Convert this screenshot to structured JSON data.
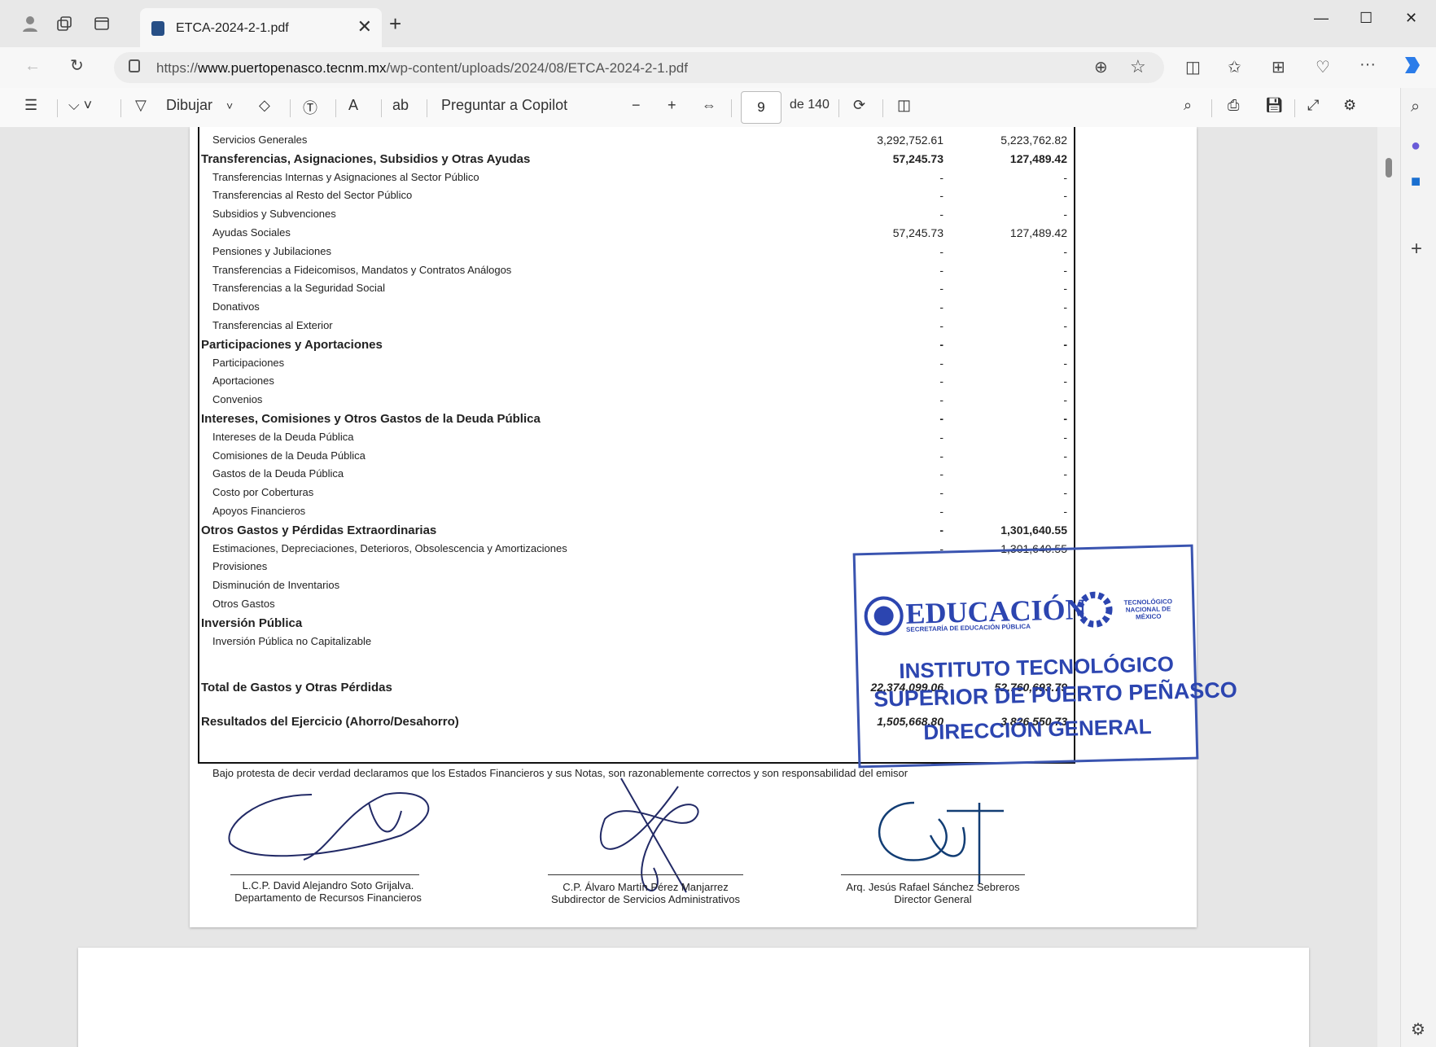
{
  "browser": {
    "tab_title": "ETCA-2024-2-1.pdf",
    "url_prefix": "https://",
    "url_host": "www.puertopenasco.tecnm.mx",
    "url_path": "/wp-content/uploads/2024/08/ETCA-2024-2-1.pdf"
  },
  "pdf_toolbar": {
    "draw_label": "Dibujar",
    "copilot_label": "Preguntar a Copilot",
    "page_number": "9",
    "page_total": "de 140"
  },
  "document": {
    "rows": [
      {
        "label": "Servicios Generales",
        "kind": "sub",
        "v1": "3,292,752.61",
        "v2": "5,223,762.82"
      },
      {
        "label": "Transferencias, Asignaciones, Subsidios y Otras Ayudas",
        "kind": "head",
        "v1": "57,245.73",
        "v2": "127,489.42"
      },
      {
        "label": "Transferencias Internas y Asignaciones al Sector Público",
        "kind": "sub",
        "v1": "-",
        "v2": "-"
      },
      {
        "label": "Transferencias al Resto del Sector Público",
        "kind": "sub",
        "v1": "-",
        "v2": "-"
      },
      {
        "label": "Subsidios y Subvenciones",
        "kind": "sub",
        "v1": "-",
        "v2": "-"
      },
      {
        "label": "Ayudas Sociales",
        "kind": "sub",
        "v1": "57,245.73",
        "v2": "127,489.42"
      },
      {
        "label": "Pensiones y Jubilaciones",
        "kind": "sub",
        "v1": "-",
        "v2": "-"
      },
      {
        "label": "Transferencias a Fideicomisos, Mandatos y Contratos Análogos",
        "kind": "sub",
        "v1": "-",
        "v2": "-"
      },
      {
        "label": "Transferencias a la Seguridad Social",
        "kind": "sub",
        "v1": "-",
        "v2": "-"
      },
      {
        "label": "Donativos",
        "kind": "sub",
        "v1": "-",
        "v2": "-"
      },
      {
        "label": "Transferencias al Exterior",
        "kind": "sub",
        "v1": "-",
        "v2": "-"
      },
      {
        "label": "Participaciones y Aportaciones",
        "kind": "head",
        "v1": "-",
        "v2": "-"
      },
      {
        "label": "Participaciones",
        "kind": "sub",
        "v1": "-",
        "v2": "-"
      },
      {
        "label": "Aportaciones",
        "kind": "sub",
        "v1": "-",
        "v2": "-"
      },
      {
        "label": "Convenios",
        "kind": "sub",
        "v1": "-",
        "v2": "-"
      },
      {
        "label": "Intereses, Comisiones y Otros Gastos de la Deuda Pública",
        "kind": "head",
        "v1": "-",
        "v2": "-"
      },
      {
        "label": "Intereses de la Deuda Pública",
        "kind": "sub",
        "v1": "-",
        "v2": "-"
      },
      {
        "label": "Comisiones de la Deuda Pública",
        "kind": "sub",
        "v1": "-",
        "v2": "-"
      },
      {
        "label": "Gastos de la Deuda Pública",
        "kind": "sub",
        "v1": "-",
        "v2": "-"
      },
      {
        "label": "Costo por Coberturas",
        "kind": "sub",
        "v1": "-",
        "v2": "-"
      },
      {
        "label": "Apoyos Financieros",
        "kind": "sub",
        "v1": "-",
        "v2": "-"
      },
      {
        "label": "Otros Gastos y Pérdidas Extraordinarias",
        "kind": "head",
        "v1": "-",
        "v2": "1,301,640.55"
      },
      {
        "label": "Estimaciones, Depreciaciones, Deterioros, Obsolescencia y Amortizaciones",
        "kind": "sub",
        "v1": "-",
        "v2": "1,301,640.55"
      },
      {
        "label": "Provisiones",
        "kind": "sub",
        "v1": "",
        "v2": ""
      },
      {
        "label": "Disminución de Inventarios",
        "kind": "sub",
        "v1": "",
        "v2": ""
      },
      {
        "label": "Otros Gastos",
        "kind": "sub",
        "v1": "",
        "v2": ""
      },
      {
        "label": "Inversión Pública",
        "kind": "head",
        "v1": "",
        "v2": ""
      },
      {
        "label": "Inversión Pública no Capitalizable",
        "kind": "sub",
        "v1": "",
        "v2": ""
      }
    ],
    "total_label": "Total de Gastos y Otras Pérdidas",
    "total_v1": "22,374,099.06",
    "total_v2": "52,760,693.79",
    "result_label": "Resultados del Ejercicio (Ahorro/Desahorro)",
    "result_v1": "1,505,668.80",
    "result_v2": "3,826,550.73",
    "declaration": "Bajo protesta de decir verdad declaramos que los Estados Financieros y sus Notas, son razonablemente correctos y son responsabilidad del emisor",
    "signatories": [
      {
        "name": "L.C.P. David Alejandro Soto Grijalva.",
        "role": "Departamento de Recursos Financieros"
      },
      {
        "name": "C.P. Álvaro Martín Pérez Manjarrez",
        "role": "Subdirector de Servicios Administrativos"
      },
      {
        "name": "Arq. Jesús Rafael Sánchez Sebreros",
        "role": "Director General"
      }
    ],
    "stamp": {
      "logo_text": "EDUCACIÓN",
      "logo_sub": "SECRETARÍA DE EDUCACIÓN PÚBLICA",
      "tecnm": "TECNOLÓGICO NACIONAL DE MÉXICO",
      "line1": "INSTITUTO TECNOLÓGICO",
      "line2": "SUPERIOR DE PUERTO PEÑASCO",
      "line3": "DIRECCIÓN GENERAL"
    }
  }
}
